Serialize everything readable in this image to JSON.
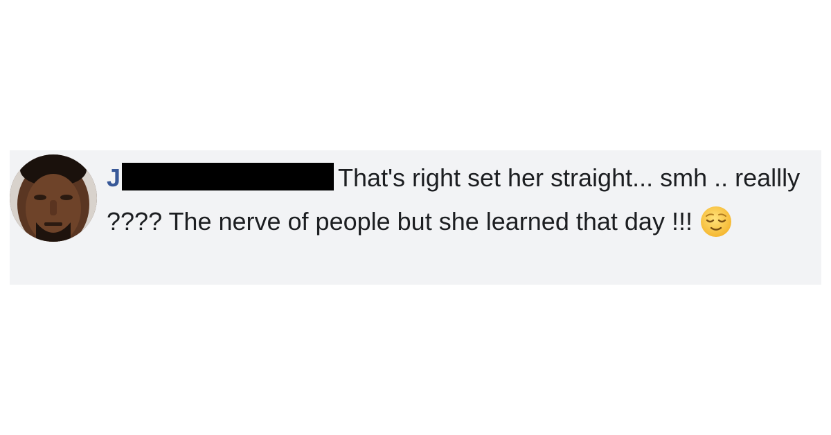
{
  "comment": {
    "author_initial": "J",
    "author_name_redacted": true,
    "text": "That's right set her straight... smh .. reallly ???? The nerve of people but she learned that day !!!",
    "emoji": "relieved-face-icon"
  },
  "colors": {
    "background": "#ffffff",
    "comment_bubble": "#f2f3f5",
    "author_link": "#385898",
    "text": "#1c1e21",
    "redaction": "#000000",
    "emoji_face": "#fcc83c"
  }
}
